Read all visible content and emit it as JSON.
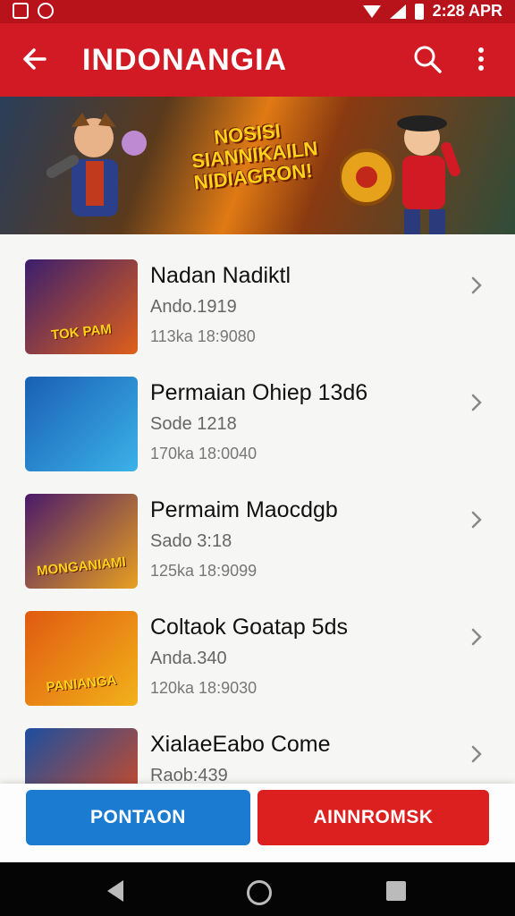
{
  "status_bar": {
    "time": "2:28 APR",
    "icons": [
      "gallery-icon",
      "camera-icon",
      "wifi-icon",
      "signal-icon",
      "battery-icon"
    ]
  },
  "app_bar": {
    "title": "INDONANGIA",
    "back_icon": "arrow-left-icon",
    "search_icon": "search-icon",
    "more_icon": "more-vertical-icon"
  },
  "banner": {
    "title_lines": [
      "NOSISI",
      "SIANNIKAILN",
      "NIDIAGRON!"
    ]
  },
  "games": [
    {
      "name": "Nadan Nadiktl",
      "subtitle": "Ando.1919",
      "meta": "113ka 18:9080",
      "thumb_text": "TOK PAM",
      "colors": [
        "#3a1e6e",
        "#e0601a"
      ]
    },
    {
      "name": "Permaian Ohiep 13d6",
      "subtitle": "Sode 1218",
      "meta": "170ka 18:0040",
      "thumb_text": "",
      "colors": [
        "#1a5fb4",
        "#3bb2e8"
      ]
    },
    {
      "name": "Permaim Maocdgb",
      "subtitle": "Sado 3:18",
      "meta": "125ka 18:9099",
      "thumb_text": "MONGANIAMI",
      "colors": [
        "#4a1a6a",
        "#e8a020"
      ]
    },
    {
      "name": "Coltaok Goatap 5ds",
      "subtitle": "Anda.340",
      "meta": "120ka 18:9030",
      "thumb_text": "PANIANGA",
      "colors": [
        "#e05a10",
        "#f2b21a"
      ]
    },
    {
      "name": "XialaeEabo Come",
      "subtitle": "Raob:439",
      "meta": "",
      "thumb_text": "",
      "colors": [
        "#1b4fa0",
        "#e04a1a"
      ]
    }
  ],
  "buttons": {
    "primary": "PONTAON",
    "secondary": "AINNROMSK"
  },
  "nav_bar": {
    "icons": [
      "nav-back-icon",
      "nav-home-icon",
      "nav-recent-icon"
    ]
  },
  "colors": {
    "app_bar": "#d21a24",
    "status_bar": "#b8121b",
    "primary_button": "#1b7bd1",
    "secondary_button": "#dc1f1f"
  }
}
